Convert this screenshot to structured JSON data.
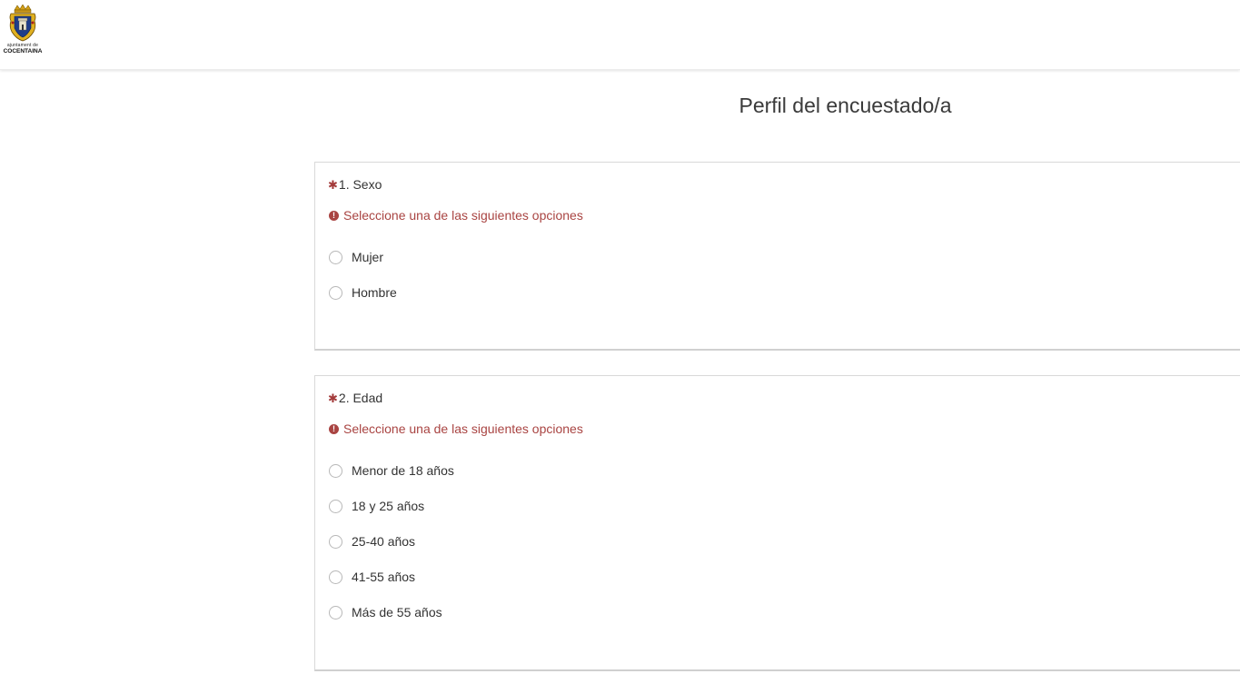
{
  "header": {
    "logo_small_text": "ajuntament de",
    "logo_big_text": "COCENTAINA"
  },
  "page": {
    "title": "Perfil del encuestado/a"
  },
  "questions": [
    {
      "asterisk": "✱",
      "title": "1. Sexo",
      "error_icon": "!",
      "error": "Seleccione una de las siguientes opciones",
      "options": [
        "Mujer",
        "Hombre"
      ]
    },
    {
      "asterisk": "✱",
      "title": "2. Edad",
      "error_icon": "!",
      "error": "Seleccione una de las siguientes opciones",
      "options": [
        "Menor de 18 años",
        "18 y 25 años",
        "25-40 años",
        "41-55 años",
        "Más de 55 años"
      ]
    }
  ],
  "colors": {
    "error": "#a94442",
    "asterisk": "#a33a3a",
    "border": "#d9d9d9"
  }
}
